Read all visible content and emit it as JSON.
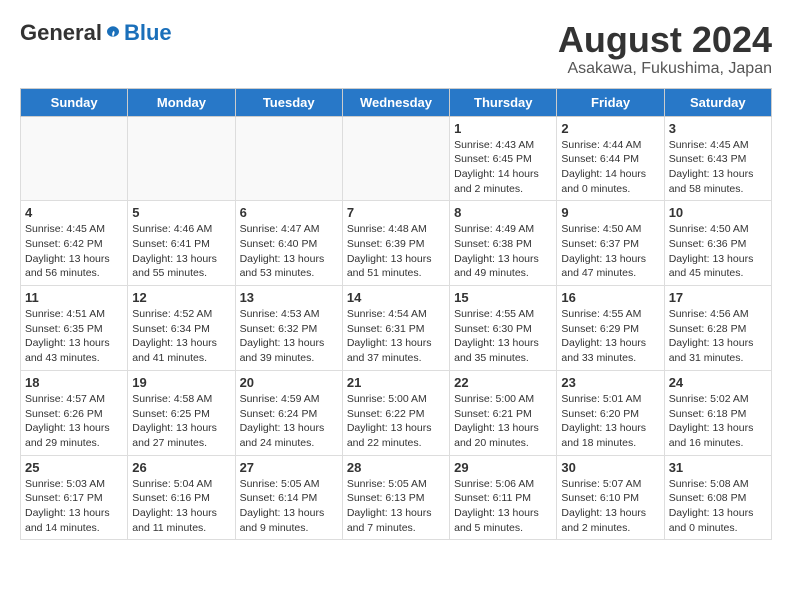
{
  "header": {
    "logo_general": "General",
    "logo_blue": "Blue",
    "title": "August 2024",
    "subtitle": "Asakawa, Fukushima, Japan"
  },
  "calendar": {
    "days_of_week": [
      "Sunday",
      "Monday",
      "Tuesday",
      "Wednesday",
      "Thursday",
      "Friday",
      "Saturday"
    ],
    "weeks": [
      [
        {
          "day": null,
          "info": null
        },
        {
          "day": null,
          "info": null
        },
        {
          "day": null,
          "info": null
        },
        {
          "day": null,
          "info": null
        },
        {
          "day": "1",
          "info": "Sunrise: 4:43 AM\nSunset: 6:45 PM\nDaylight: 14 hours\nand 2 minutes."
        },
        {
          "day": "2",
          "info": "Sunrise: 4:44 AM\nSunset: 6:44 PM\nDaylight: 14 hours\nand 0 minutes."
        },
        {
          "day": "3",
          "info": "Sunrise: 4:45 AM\nSunset: 6:43 PM\nDaylight: 13 hours\nand 58 minutes."
        }
      ],
      [
        {
          "day": "4",
          "info": "Sunrise: 4:45 AM\nSunset: 6:42 PM\nDaylight: 13 hours\nand 56 minutes."
        },
        {
          "day": "5",
          "info": "Sunrise: 4:46 AM\nSunset: 6:41 PM\nDaylight: 13 hours\nand 55 minutes."
        },
        {
          "day": "6",
          "info": "Sunrise: 4:47 AM\nSunset: 6:40 PM\nDaylight: 13 hours\nand 53 minutes."
        },
        {
          "day": "7",
          "info": "Sunrise: 4:48 AM\nSunset: 6:39 PM\nDaylight: 13 hours\nand 51 minutes."
        },
        {
          "day": "8",
          "info": "Sunrise: 4:49 AM\nSunset: 6:38 PM\nDaylight: 13 hours\nand 49 minutes."
        },
        {
          "day": "9",
          "info": "Sunrise: 4:50 AM\nSunset: 6:37 PM\nDaylight: 13 hours\nand 47 minutes."
        },
        {
          "day": "10",
          "info": "Sunrise: 4:50 AM\nSunset: 6:36 PM\nDaylight: 13 hours\nand 45 minutes."
        }
      ],
      [
        {
          "day": "11",
          "info": "Sunrise: 4:51 AM\nSunset: 6:35 PM\nDaylight: 13 hours\nand 43 minutes."
        },
        {
          "day": "12",
          "info": "Sunrise: 4:52 AM\nSunset: 6:34 PM\nDaylight: 13 hours\nand 41 minutes."
        },
        {
          "day": "13",
          "info": "Sunrise: 4:53 AM\nSunset: 6:32 PM\nDaylight: 13 hours\nand 39 minutes."
        },
        {
          "day": "14",
          "info": "Sunrise: 4:54 AM\nSunset: 6:31 PM\nDaylight: 13 hours\nand 37 minutes."
        },
        {
          "day": "15",
          "info": "Sunrise: 4:55 AM\nSunset: 6:30 PM\nDaylight: 13 hours\nand 35 minutes."
        },
        {
          "day": "16",
          "info": "Sunrise: 4:55 AM\nSunset: 6:29 PM\nDaylight: 13 hours\nand 33 minutes."
        },
        {
          "day": "17",
          "info": "Sunrise: 4:56 AM\nSunset: 6:28 PM\nDaylight: 13 hours\nand 31 minutes."
        }
      ],
      [
        {
          "day": "18",
          "info": "Sunrise: 4:57 AM\nSunset: 6:26 PM\nDaylight: 13 hours\nand 29 minutes."
        },
        {
          "day": "19",
          "info": "Sunrise: 4:58 AM\nSunset: 6:25 PM\nDaylight: 13 hours\nand 27 minutes."
        },
        {
          "day": "20",
          "info": "Sunrise: 4:59 AM\nSunset: 6:24 PM\nDaylight: 13 hours\nand 24 minutes."
        },
        {
          "day": "21",
          "info": "Sunrise: 5:00 AM\nSunset: 6:22 PM\nDaylight: 13 hours\nand 22 minutes."
        },
        {
          "day": "22",
          "info": "Sunrise: 5:00 AM\nSunset: 6:21 PM\nDaylight: 13 hours\nand 20 minutes."
        },
        {
          "day": "23",
          "info": "Sunrise: 5:01 AM\nSunset: 6:20 PM\nDaylight: 13 hours\nand 18 minutes."
        },
        {
          "day": "24",
          "info": "Sunrise: 5:02 AM\nSunset: 6:18 PM\nDaylight: 13 hours\nand 16 minutes."
        }
      ],
      [
        {
          "day": "25",
          "info": "Sunrise: 5:03 AM\nSunset: 6:17 PM\nDaylight: 13 hours\nand 14 minutes."
        },
        {
          "day": "26",
          "info": "Sunrise: 5:04 AM\nSunset: 6:16 PM\nDaylight: 13 hours\nand 11 minutes."
        },
        {
          "day": "27",
          "info": "Sunrise: 5:05 AM\nSunset: 6:14 PM\nDaylight: 13 hours\nand 9 minutes."
        },
        {
          "day": "28",
          "info": "Sunrise: 5:05 AM\nSunset: 6:13 PM\nDaylight: 13 hours\nand 7 minutes."
        },
        {
          "day": "29",
          "info": "Sunrise: 5:06 AM\nSunset: 6:11 PM\nDaylight: 13 hours\nand 5 minutes."
        },
        {
          "day": "30",
          "info": "Sunrise: 5:07 AM\nSunset: 6:10 PM\nDaylight: 13 hours\nand 2 minutes."
        },
        {
          "day": "31",
          "info": "Sunrise: 5:08 AM\nSunset: 6:08 PM\nDaylight: 13 hours\nand 0 minutes."
        }
      ]
    ]
  }
}
